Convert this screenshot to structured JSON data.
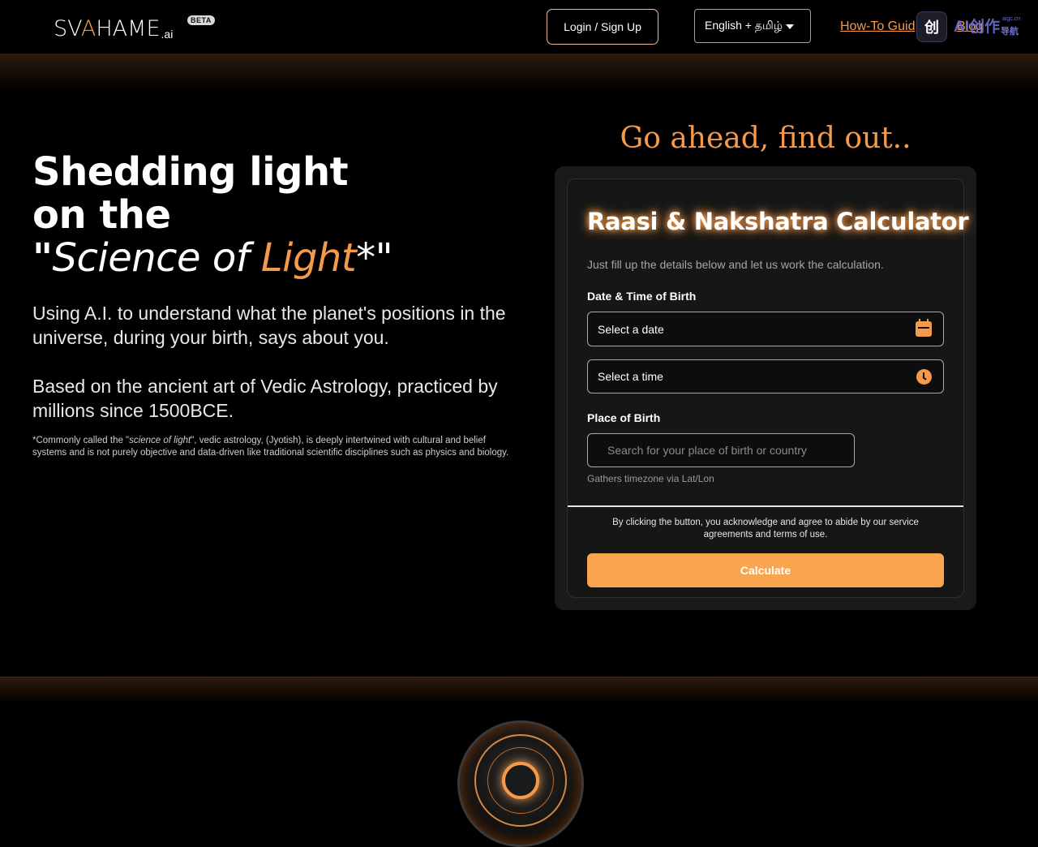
{
  "header": {
    "logo_text_1": "SV",
    "logo_text_a": "A",
    "logo_text_2": "HAME",
    "logo_suffix": ".ai",
    "beta_badge": "BETA",
    "login_label": "Login / Sign Up",
    "language_selected": "English + தமிழ்",
    "nav_guide": "How-To Guid",
    "nav_blog": "Blog",
    "ext_icon": "创",
    "ext_text": "AI创作",
    "ext_sub": "导航",
    "ext_sub_small": "aigc.cn"
  },
  "hero": {
    "title_line1": "Shedding light",
    "title_line2": "on the",
    "title_quote_open": "\"",
    "title_science": "Science of ",
    "title_light": "Light",
    "title_end": "*\"",
    "paragraph1": "Using A.I. to understand what the planet's positions in the universe, during your birth, says about you.",
    "paragraph2": "Based on the ancient art of Vedic Astrology, practiced by millions since 1500BCE.",
    "footnote_prefix": "*Commonly called the \"",
    "footnote_italic": "science of light",
    "footnote_suffix": "\", vedic astrology, (Jyotish), is deeply intertwined with cultural and belief systems and is not purely objective and data-driven like traditional scientific disciplines such as physics and biology."
  },
  "form": {
    "cta": "Go ahead, find out..",
    "title": "Raasi & Nakshatra Calculator",
    "subtitle": "Just fill up the details below and let us work the calculation.",
    "date_time_label": "Date & Time of Birth",
    "date_placeholder": "Select a date",
    "time_placeholder": "Select a time",
    "place_label": "Place of Birth",
    "place_placeholder": "Search for your place of birth or country",
    "place_hint": "Gathers timezone via Lat/Lon",
    "terms": "By clicking the button, you acknowledge and agree to abide by our service agreements and terms of use.",
    "calculate_label": "Calculate"
  },
  "colors": {
    "accent": "#f59a4a",
    "button": "#f9a54f",
    "background": "#000000",
    "card": "#1a1a1a"
  },
  "icons": {
    "date": "calendar-icon",
    "time": "clock-icon",
    "language": "chevron-down-icon"
  }
}
